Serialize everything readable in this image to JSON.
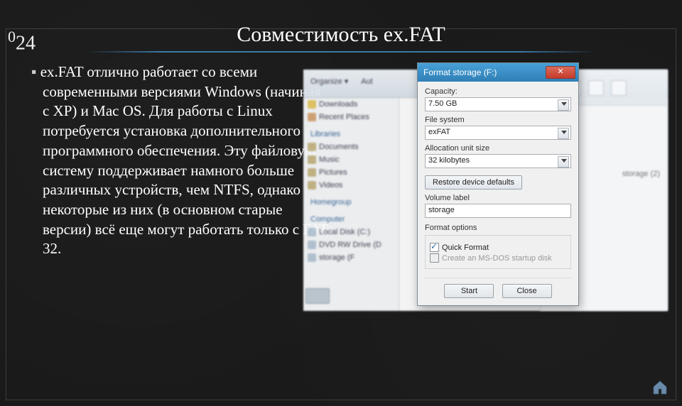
{
  "slide": {
    "number_prefix": "0",
    "number": "24",
    "title": "Совместимость ex.FAT",
    "bullet_text": "ex.FAT отлично работает со всеми современными версиями Windows (начиная с XP) и Mac OS. Для работы с Linux потребуется установка дополнительного программного обеспечения. Эту файловую систему поддерживает намного больше различных устройств, чем NTFS, однако некоторые из них (в основном старые версии) всё еще могут работать только с FAT 32."
  },
  "bg_window": {
    "toolbar": {
      "organize": "Organize ▾",
      "autoplay": "Aut"
    },
    "sidebar": {
      "downloads": "Downloads",
      "recent": "Recent Places",
      "libraries_hdr": "Libraries",
      "documents": "Documents",
      "music": "Music",
      "pictures": "Pictures",
      "videos": "Videos",
      "homegroup_hdr": "Homegroup",
      "computer_hdr": "Computer",
      "local_disk": "Local Disk (C:)",
      "dvd": "DVD RW Drive (D",
      "storage": "storage (F"
    }
  },
  "bg_right": {
    "storage_label": "storage (2)"
  },
  "dialog": {
    "title": "Format storage (F:)",
    "capacity_label": "Capacity:",
    "capacity_value": "7.50 GB",
    "filesystem_label": "File system",
    "filesystem_value": "exFAT",
    "alloc_label": "Allocation unit size",
    "alloc_value": "32 kilobytes",
    "restore_label": "Restore device defaults",
    "volume_label": "Volume label",
    "volume_value": "storage",
    "options_label": "Format options",
    "quick_format": "Quick Format",
    "msdos": "Create an MS-DOS startup disk",
    "start": "Start",
    "close": "Close"
  }
}
